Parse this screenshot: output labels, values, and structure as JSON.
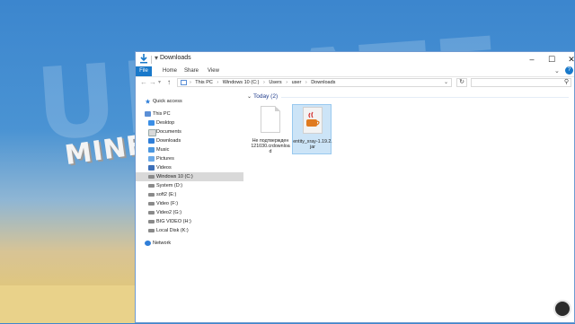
{
  "window": {
    "title": "Downloads"
  },
  "ribbon": {
    "tabs": [
      "File",
      "Home",
      "Share",
      "View"
    ]
  },
  "address": {
    "crumbs": [
      "This PC",
      "Windows 10 (C:)",
      "Users",
      "user",
      "Downloads"
    ]
  },
  "nav": {
    "items": [
      {
        "label": "Quick access",
        "icon": "star-icon",
        "selected": false
      },
      {
        "label": "This PC",
        "icon": "pc-icon",
        "selected": false
      },
      {
        "label": "Desktop",
        "icon": "folder-desktop-icon",
        "selected": false
      },
      {
        "label": "Documents",
        "icon": "folder-documents-icon",
        "selected": false
      },
      {
        "label": "Downloads",
        "icon": "folder-downloads-icon",
        "selected": false
      },
      {
        "label": "Music",
        "icon": "folder-music-icon",
        "selected": false
      },
      {
        "label": "Pictures",
        "icon": "folder-pictures-icon",
        "selected": false
      },
      {
        "label": "Videos",
        "icon": "folder-videos-icon",
        "selected": false
      },
      {
        "label": "Windows 10 (C:)",
        "icon": "drive-icon",
        "selected": true
      },
      {
        "label": "System (D:)",
        "icon": "drive-icon",
        "selected": false
      },
      {
        "label": "soft2 (E:)",
        "icon": "drive-icon",
        "selected": false
      },
      {
        "label": "Video (F:)",
        "icon": "drive-icon",
        "selected": false
      },
      {
        "label": "Video2 (G:)",
        "icon": "drive-icon",
        "selected": false
      },
      {
        "label": "BIG VIDEO (H:)",
        "icon": "drive-icon",
        "selected": false
      },
      {
        "label": "Local Disk (K:)",
        "icon": "drive-icon",
        "selected": false
      },
      {
        "label": "Network",
        "icon": "network-icon",
        "selected": false
      }
    ]
  },
  "content": {
    "group_header": "Today (2)",
    "files": [
      {
        "name": "Не подтвержден 121030.crdownload",
        "icon": "document-icon",
        "selected": false
      },
      {
        "name": "entity_xray-1.19.2.jar",
        "icon": "java-jar-icon",
        "selected": true
      }
    ]
  },
  "desktop": {
    "background_text": "MINE"
  },
  "colors": {
    "accent": "#1979ca",
    "selection": "#cce4f7",
    "nav_selected": "#d9d9d9"
  }
}
